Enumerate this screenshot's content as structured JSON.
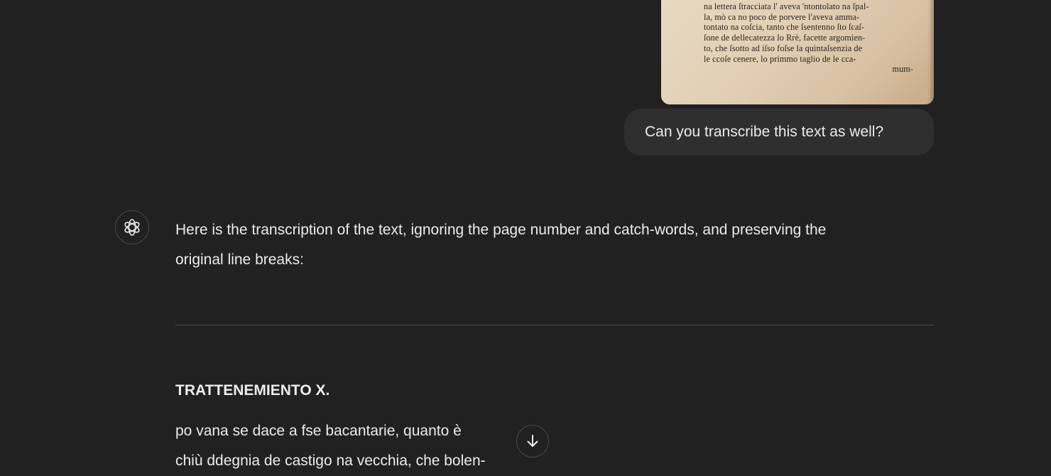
{
  "attachment": {
    "lines": [
      "na lettera ſtracciata l' aveva 'ntontolato na ſpal-",
      "la, mò ca no poco de porvere l'aveva amma-",
      "tontato na coſcia, tanto che ſsentenno ſto ſcaſ-",
      "ſone de dellecatezza lo Rrè, facette argomien-",
      "to, che ſsotto ad iſso foſse la quintaſsenzia de",
      "le ccoſe cenere, lo primmo taglio de le cca-",
      "mum-"
    ]
  },
  "user_message": {
    "text": "Can you transcribe this text as well?"
  },
  "assistant": {
    "avatar_icon": "openai-logo-icon",
    "intro_lines": [
      "Here is the transcription of the text, ignoring the page number and catch-words, and preserving the",
      "original line breaks:"
    ],
    "heading": "TRATTENEMIENTO X.",
    "body_lines": [
      "po vana se dace a fse bacantarie, quanto è",
      "chiù ddegnia de castigo na vecchia, che bolen-"
    ]
  },
  "scroll_button": {
    "icon": "arrow-down-icon"
  },
  "colors": {
    "background": "#212121",
    "bubble": "#2f2f2f",
    "text": "#ececec",
    "divider": "#4d4d4d"
  }
}
